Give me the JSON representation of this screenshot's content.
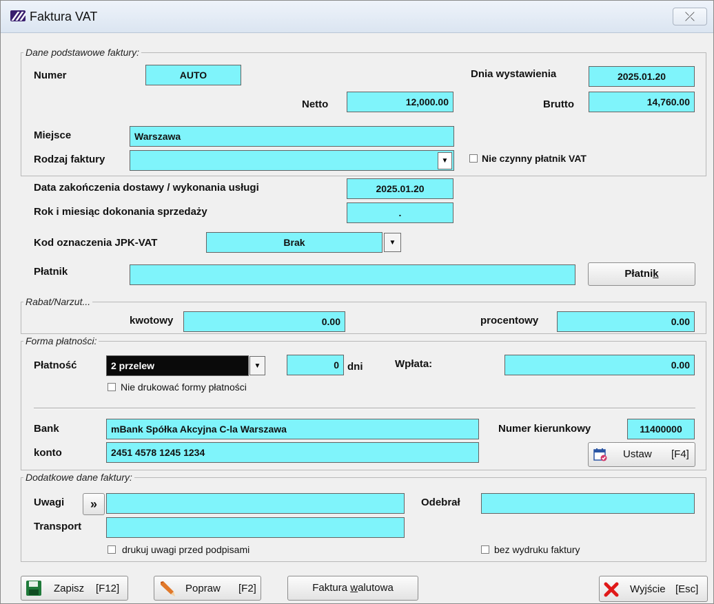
{
  "window": {
    "title": "Faktura VAT",
    "close_glyph": "⤫"
  },
  "dane": {
    "legend": "Dane podstawowe faktury:",
    "numer_label": "Numer",
    "numer_value": "AUTO",
    "dnia_label": "Dnia wystawienia",
    "dnia_value": "2025.01.20",
    "netto_label": "Netto",
    "netto_value": "12,000.00",
    "brutto_label": "Brutto",
    "brutto_value": "14,760.00",
    "miejsce_label": "Miejsce",
    "miejsce_value": "Warszawa",
    "rodzaj_label": "Rodzaj faktury",
    "rodzaj_value": "",
    "nieczynny_label": "Nie czynny płatnik VAT"
  },
  "dostawa": {
    "data_label": "Data zakończenia dostawy / wykonania usługi",
    "data_value": "2025.01.20",
    "rok_label": "Rok i miesiąc dokonania sprzedaży",
    "rok_value": "."
  },
  "jpk": {
    "label": "Kod oznaczenia JPK-VAT",
    "value": "Brak"
  },
  "platnik": {
    "label": "Płatnik",
    "value": "",
    "button_pre": "Płatni",
    "button_u": "k"
  },
  "rabat": {
    "legend": "Rabat/Narzut...",
    "kwotowy_label": "kwotowy",
    "kwotowy_value": "0.00",
    "procentowy_label": "procentowy",
    "procentowy_value": "0.00"
  },
  "forma": {
    "legend": "Forma płatności:",
    "platnosc_label": "Płatność",
    "platnosc_value": "2 przelew",
    "dni_value": "0",
    "dni_label": "dni",
    "wplata_label": "Wpłata:",
    "wplata_value": "0.00",
    "nie_drukowac_label": "Nie drukować formy płatności"
  },
  "bank": {
    "bank_label": "Bank",
    "bank_value": "mBank Spółka Akcyjna C-la Warszawa",
    "numer_kier_label": "Numer kierunkowy",
    "numer_kier_value": "11400000",
    "konto_label": "konto",
    "konto_value": "2451 4578 1245 1234",
    "ustaw_label": "Ustaw",
    "ustaw_key": "[F4]"
  },
  "dodatkowe": {
    "legend": "Dodatkowe dane faktury:",
    "uwagi_label": "Uwagi",
    "uwagi_btn": "»",
    "uwagi_value": "",
    "odebral_label": "Odebrał",
    "odebral_value": "",
    "transport_label": "Transport",
    "transport_value": "",
    "drukuj_uwagi_label": "drukuj uwagi przed podpisami",
    "bez_wydruku_label": "bez wydruku faktury"
  },
  "footer": {
    "zapisz_label": "Zapisz",
    "zapisz_key": "[F12]",
    "popraw_label": "Popraw",
    "popraw_key": "[F2]",
    "faktura_pre": "Faktura ",
    "faktura_u": "w",
    "faktura_post": "alutowa",
    "wyjscie_label": "Wyjście",
    "wyjscie_key": "[Esc]"
  },
  "colors": {
    "field": "#7ff4fb",
    "selection": "#0a0a0a",
    "save_icon": "#1f7a3a",
    "exit_icon": "#e01818",
    "pencil_icon": "#e0782a"
  },
  "icons": [
    "app-logo-icon",
    "close-icon",
    "dropdown-arrow-icon",
    "calendar-icon",
    "floppy-disk-icon",
    "pencil-icon",
    "red-x-icon"
  ]
}
